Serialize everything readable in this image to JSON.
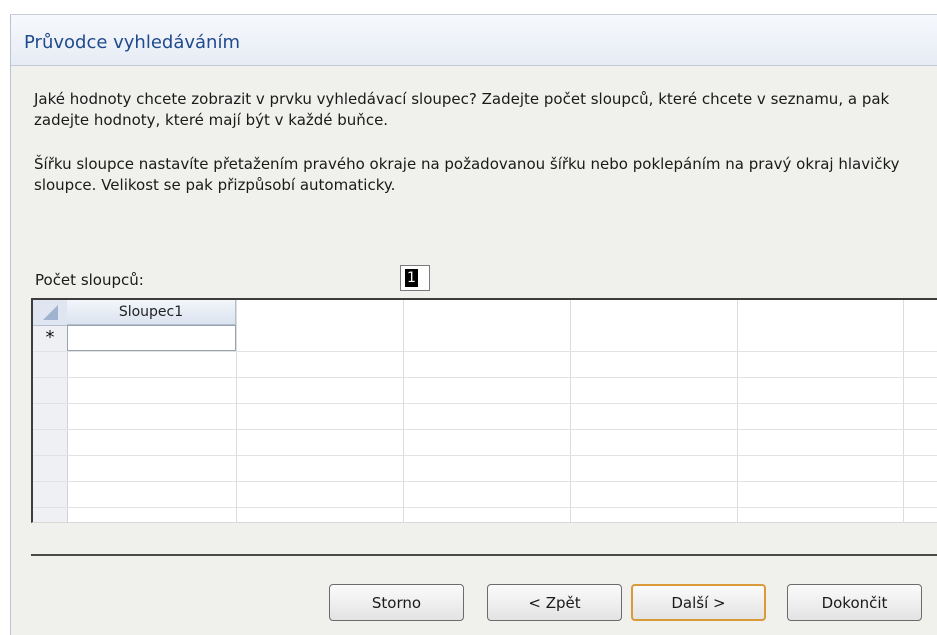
{
  "window": {
    "title": "Průvodce vyhledáváním"
  },
  "description": {
    "paragraph1": "Jaké hodnoty chcete zobrazit v prvku vyhledávací sloupec? Zadejte počet sloupců, které chcete v seznamu, a pak zadejte hodnoty, které mají být v každé buňce.",
    "paragraph2": "Šířku sloupce nastavíte přetažením pravého okraje na požadovanou šířku nebo poklepáním na pravý okraj hlavičky sloupce. Velikost se pak přizpůsobí automaticky."
  },
  "column_count": {
    "label": "Počet sloupců:",
    "value": "1"
  },
  "grid": {
    "columns": [
      "Sloupec1"
    ],
    "new_row_marker": "*"
  },
  "buttons": {
    "cancel": "Storno",
    "back": "< Zpět",
    "next": "Další >",
    "finish": "Dokončit"
  }
}
